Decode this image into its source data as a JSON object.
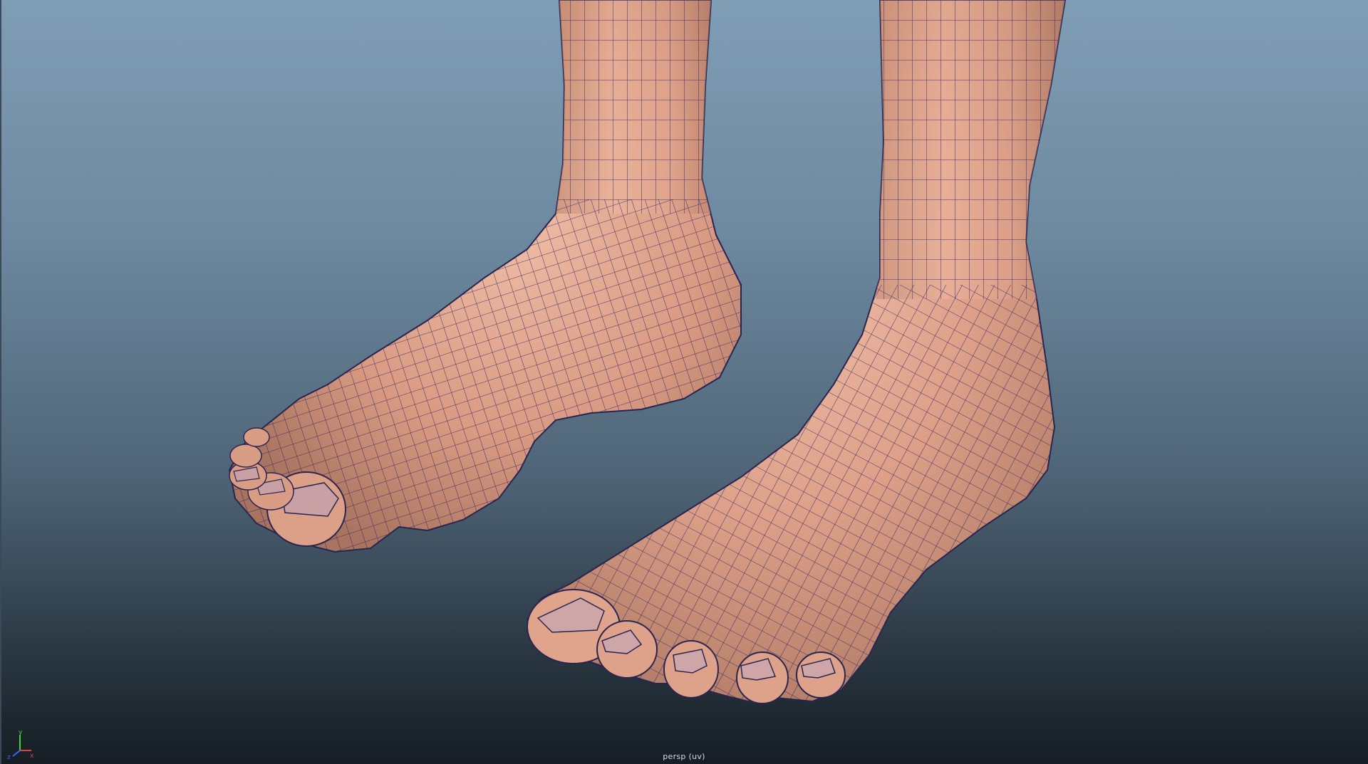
{
  "viewport": {
    "camera_label": "persp (uv)",
    "background_top": "#7f9db5",
    "background_bottom": "#161d24"
  },
  "model": {
    "name": "feet-mesh",
    "skin_color": "#e4a98f",
    "wire_color": "#2d2460",
    "display_mode": "wireframe-on-shaded"
  },
  "axis_gizmo": {
    "x_label": "x",
    "y_label": "y",
    "z_label": "z",
    "x_color": "#e04040",
    "y_color": "#40d040",
    "z_color": "#4060ff"
  }
}
